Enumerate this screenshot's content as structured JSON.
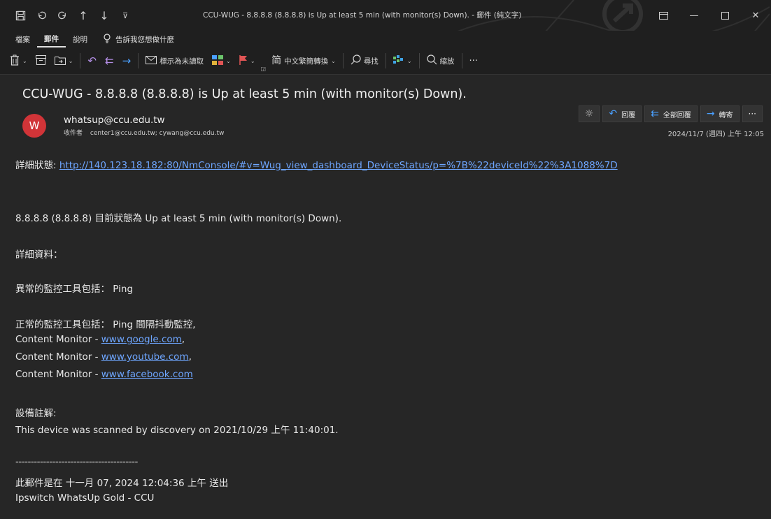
{
  "window": {
    "title": "CCU-WUG - 8.8.8.8 (8.8.8.8) is Up at least 5 min (with monitor(s) Down). - 郵件 (純文字)",
    "quick_icons": [
      "save-icon",
      "undo-icon",
      "redo-icon",
      "up-arrow-icon",
      "down-arrow-icon",
      "customize-icon"
    ],
    "controls": [
      "ribbon-display-icon",
      "minimize-icon",
      "maximize-icon",
      "close-icon"
    ]
  },
  "menu": {
    "items": [
      "檔案",
      "郵件",
      "說明"
    ],
    "active": "郵件",
    "tell_me": "告訴我您想做什麼"
  },
  "ribbon": {
    "mark_unread": "標示為未讀取",
    "convert": "中文繁簡轉換",
    "find": "尋找",
    "zoom": "縮放",
    "more": "···"
  },
  "message": {
    "subject": "CCU-WUG - 8.8.8.8 (8.8.8.8) is Up at least 5 min (with monitor(s) Down).",
    "avatar_letter": "W",
    "sender": "whatsup@ccu.edu.tw",
    "recipients_label": "收件者",
    "recipients": "center1@ccu.edu.tw; cywang@ccu.edu.tw",
    "date": "2024/11/7 (週四) 上午 12:05",
    "actions": {
      "reply": "回覆",
      "reply_all": "全部回覆",
      "forward": "轉寄",
      "more": "···"
    }
  },
  "body": {
    "details_label": "詳細狀態:",
    "details_url": "http://140.123.18.182:80/NmConsole/#v=Wug_view_dashboard_DeviceStatus/p=%7B%22deviceId%22%3A1088%7D",
    "status_line": "8.8.8.8 (8.8.8.8) 目前狀態為  Up at least 5 min (with monitor(s) Down).",
    "details_header": "詳細資料：",
    "abnormal": "異常的監控工具包括： Ping",
    "normal": "正常的監控工具包括： Ping 間隔抖動監控,",
    "content_prefix": "Content Monitor - ",
    "content_sites": [
      "www.google.com",
      "www.youtube.com",
      "www.facebook.com"
    ],
    "content_sep": ",",
    "notes_label": "設備註解:",
    "notes_text": "This device was scanned by discovery on 2021/10/29  上午  11:40:01.",
    "divider": "----------------------------------------",
    "sent_line": "此郵件是在  十一月 07, 2024 12:04:36 上午  送出",
    "signature": "Ipswitch WhatsUp Gold - CCU"
  },
  "colors": {
    "background": "#262626",
    "link": "#6ea6ff",
    "avatar": "#d13438",
    "accent_blue": "#4aa0ff"
  }
}
